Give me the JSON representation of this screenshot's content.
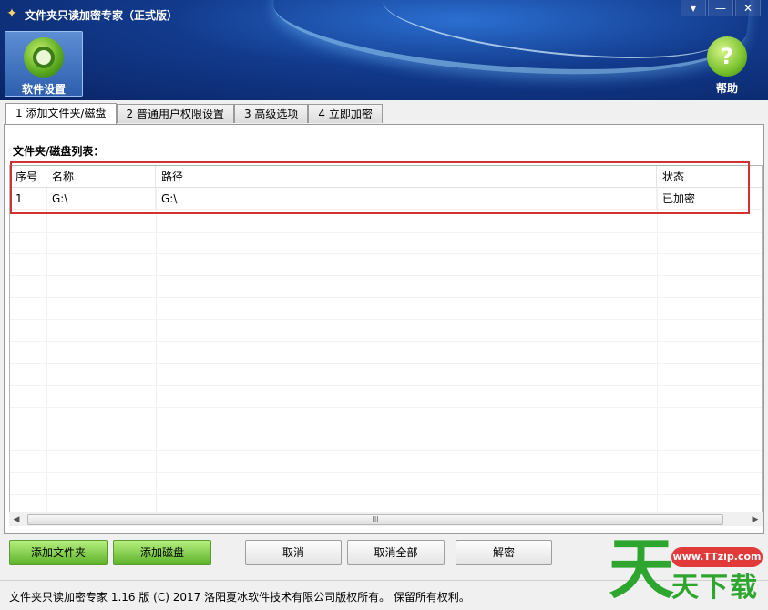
{
  "window": {
    "title": "文件夹只读加密专家（正式版）",
    "controls": {
      "menu": "▾",
      "minimize": "—",
      "close": "✕"
    }
  },
  "toolbar": {
    "settings_label": "软件设置",
    "help_label": "帮助"
  },
  "tabs": [
    {
      "label": "1 添加文件夹/磁盘",
      "active": true
    },
    {
      "label": "2 普通用户权限设置",
      "active": false
    },
    {
      "label": "3 高级选项",
      "active": false
    },
    {
      "label": "4 立即加密",
      "active": false
    }
  ],
  "list": {
    "label": "文件夹/磁盘列表：",
    "columns": [
      "序号",
      "名称",
      "路径",
      "状态"
    ],
    "rows": [
      {
        "index": "1",
        "name": "G:\\",
        "path": "G:\\",
        "status": "已加密"
      }
    ]
  },
  "buttons": {
    "add_folder": "添加文件夹",
    "add_disk": "添加磁盘",
    "cancel": "取消",
    "cancel_all": "取消全部",
    "decrypt": "解密"
  },
  "statusbar": {
    "text": "文件夹只读加密专家 1.16 版 (C) 2017 洛阳夏冰软件技术有限公司版权所有。 保留所有权利。"
  },
  "watermark": {
    "char": "天",
    "url": "www.TTzip.com",
    "text": "天下载"
  },
  "scrollbar": {
    "grip": "III",
    "left": "◀",
    "right": "▶"
  },
  "colors": {
    "header": "#123a8c",
    "accent_green": "#5db32b",
    "highlight_red": "#d23232"
  }
}
